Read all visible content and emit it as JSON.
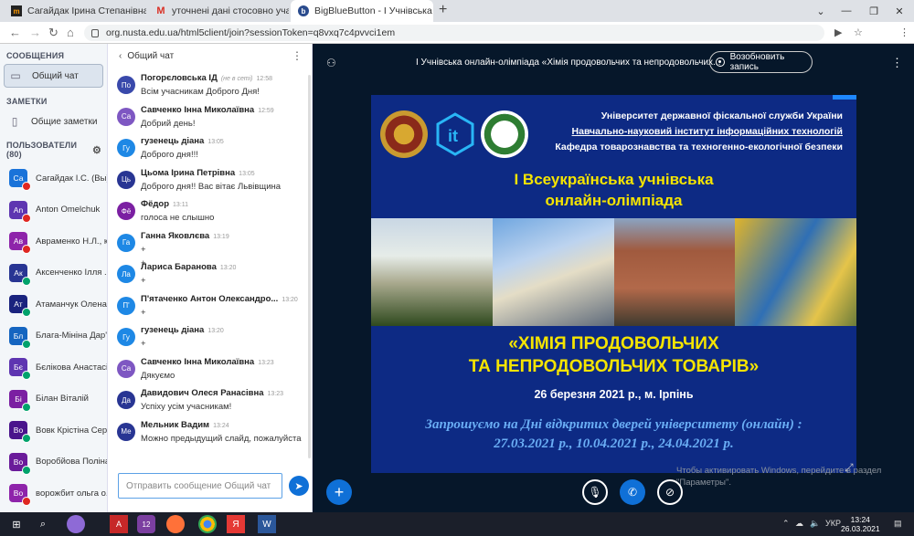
{
  "browser": {
    "tabs": [
      {
        "label": "Сагайдак Ірина Степанівна",
        "icon": "moodle-icon"
      },
      {
        "label": "уточнені дані стосовно учасник",
        "icon": "gmail-icon"
      },
      {
        "label": "BigBlueButton - І Учнівська",
        "icon": "bbb-icon"
      }
    ],
    "url": "org.nusta.edu.ua/html5client/join?sessionToken=q8vxq7c4pvvci1em"
  },
  "sidebar": {
    "messages_header": "СООБЩЕНИЯ",
    "public_chat": "Общий чат",
    "notes_header": "ЗАМЕТКИ",
    "shared_notes": "Общие заметки",
    "users_header": "ПОЛЬЗОВАТЕЛИ (80)",
    "users": [
      {
        "initials": "Са",
        "name": "Сагайдак І.С. (Вы)",
        "color": "#1a73d9",
        "status": "red"
      },
      {
        "initials": "An",
        "name": "Anton Omelchuk",
        "color": "#5e35b1",
        "status": "red"
      },
      {
        "initials": "Ав",
        "name": "Авраменко Н.Л., к...",
        "color": "#8e24aa",
        "status": "red"
      },
      {
        "initials": "Ак",
        "name": "Аксенченко Ілля ...",
        "color": "#283593",
        "status": "green"
      },
      {
        "initials": "Ат",
        "name": "Атаманчук Олена...",
        "color": "#1a237e",
        "status": "green"
      },
      {
        "initials": "Бл",
        "name": "Блага-Мініна Дар'...",
        "color": "#1565c0",
        "status": "green"
      },
      {
        "initials": "Бє",
        "name": "Бєлікова Анастасія",
        "color": "#5e35b1",
        "status": "green"
      },
      {
        "initials": "Бі",
        "name": "Білан Віталій",
        "color": "#7b1fa2",
        "status": "green"
      },
      {
        "initials": "Во",
        "name": "Вовк Крістіна Сер...",
        "color": "#4a148c",
        "status": "green"
      },
      {
        "initials": "Во",
        "name": "Воробйова Поліна",
        "color": "#6a1b9a",
        "status": "green"
      },
      {
        "initials": "Во",
        "name": "ворожбит ольга о...",
        "color": "#8e24aa",
        "status": "red"
      }
    ]
  },
  "chat": {
    "title": "Общий чат",
    "messages": [
      {
        "initials": "По",
        "name": "Погорєловська ІД",
        "time": "12:58",
        "extra": "(не в сеті)",
        "text": "Всім учасникам Доброго Дня!",
        "color": "#3949ab"
      },
      {
        "initials": "Са",
        "name": "Савченко Інна Миколаївна",
        "time": "12:59",
        "text": "Добрий день!",
        "color": "#7e57c2"
      },
      {
        "initials": "Гу",
        "name": "гузенець діана",
        "time": "13:05",
        "text": "Доброго дня!!!",
        "color": "#1e88e5"
      },
      {
        "initials": "Ць",
        "name": "Цьома Ірина Петрівна",
        "time": "13:05",
        "text": "Доброго дня!! Вас вітає Львівщина",
        "color": "#283593"
      },
      {
        "initials": "Фё",
        "name": "Фёдор",
        "time": "13:11",
        "text": "голоса не слышно",
        "color": "#7b1fa2"
      },
      {
        "initials": "Га",
        "name": "Ганна Яковлєва",
        "time": "13:19",
        "text": "+",
        "text2": "+",
        "color": "#1e88e5"
      },
      {
        "initials": "Ла",
        "name": "Лариса Баранова",
        "time": "13:20",
        "text": "+",
        "color": "#1e88e5"
      },
      {
        "initials": "П'",
        "name": "П'ятаченко Антон Олександро...",
        "time": "13:20",
        "text": "+",
        "color": "#1e88e5"
      },
      {
        "initials": "Гу",
        "name": "гузенець діана",
        "time": "13:20",
        "text": "+",
        "color": "#1e88e5"
      },
      {
        "initials": "Са",
        "name": "Савченко Інна Миколаївна",
        "time": "13:23",
        "text": "Дякуємо",
        "color": "#7e57c2"
      },
      {
        "initials": "Да",
        "name": "Давидович Олеся Ранасівна",
        "time": "13:23",
        "text": "Успіху усім учасникам!",
        "color": "#283593"
      },
      {
        "initials": "Ме",
        "name": "Мельник Вадим",
        "time": "13:24",
        "text": "Можно предыдущий слайд, пожалуйста",
        "color": "#283593"
      }
    ],
    "input_placeholder": "Отправить сообщение Общий чат"
  },
  "presentation": {
    "meeting_title": "І Учнівська онлайн-олімпіада «Хімія продовольчих та непродовольчих...",
    "record_button": "Возобновить запись",
    "slide": {
      "uni1": "Університет державної фіскальної служби України",
      "uni2": "Навчально-науковий інститут інформаційних технологій",
      "uni3": "Кафедра товарознавства та техногенно-екологічної безпеки",
      "olymp1": "І Всеукраїнська учнівська",
      "olymp2": "онлайн-олімпіада",
      "title1": "«ХІМІЯ ПРОДОВОЛЬЧИХ",
      "title2": "ТА НЕПРОДОВОЛЬЧИХ ТОВАРІВ»",
      "date": "26 березня 2021 р., м. Ірпінь",
      "invite1": "Запрошуємо на Дні відкритих дверей університету (онлайн) :",
      "invite2": "27.03.2021 р., 10.04.2021 р., 24.04.2021 р."
    },
    "watermark1": "Чтобы активировать Windows, перейдите в раздел",
    "watermark2": "\"Параметры\"."
  },
  "taskbar": {
    "lang": "УКР",
    "time": "13:24",
    "date": "26.03.2021"
  }
}
